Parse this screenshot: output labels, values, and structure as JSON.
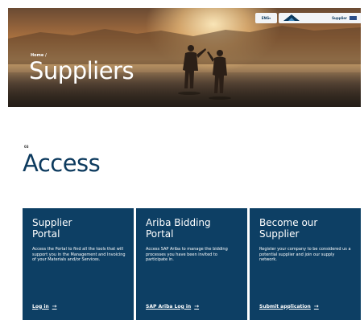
{
  "header": {
    "language": "ENG",
    "supplier_label": "Supplier"
  },
  "hero": {
    "breadcrumb": "Home /",
    "title": "Suppliers"
  },
  "section": {
    "eyebrow": "03",
    "title": "Access"
  },
  "cards": [
    {
      "title_line1": "Supplier",
      "title_line2": "Portal",
      "description": "Access the Portal to find all the tools that will support you in the Management and Invoicing of your Materials and/or Services.",
      "link_label": "Log in"
    },
    {
      "title_line1": "Ariba Bidding",
      "title_line2": "Portal",
      "description": "Access SAP Ariba to manage the bidding processes you have been invited to participate in.",
      "link_label": "SAP Ariba Log in"
    },
    {
      "title_line1": "Become our",
      "title_line2": "Supplier",
      "description": "Register your company to be considered us a potential supplier and join our supply network.",
      "link_label": "Submit application"
    }
  ],
  "colors": {
    "brand_navy": "#0d3f64",
    "title_navy": "#0c3a5e"
  }
}
